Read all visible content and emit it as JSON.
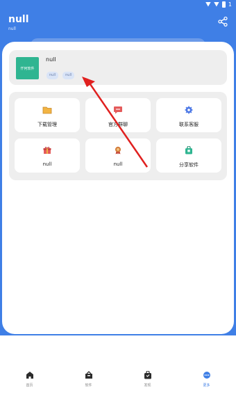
{
  "status_bar": {
    "indicator": "1"
  },
  "header": {
    "title": "null",
    "subtitle": "null",
    "share_icon": "share-icon"
  },
  "profile": {
    "name": "null",
    "avatar_text": "仟何软件",
    "tags": [
      "null",
      "null"
    ]
  },
  "grid": [
    {
      "label": "下载管理",
      "icon": "folder-icon",
      "color": "#e8a23c"
    },
    {
      "label": "官方群聊",
      "icon": "chat-icon",
      "color": "#e14b4b"
    },
    {
      "label": "联系客服",
      "icon": "gear-icon",
      "color": "#3f6de0"
    },
    {
      "label": "null",
      "icon": "gift-icon",
      "color": "#e14b4b"
    },
    {
      "label": "null",
      "icon": "badge-icon",
      "color": "#c76a2b"
    },
    {
      "label": "分享软件",
      "icon": "bag-icon",
      "color": "#2fb591"
    }
  ],
  "bottom_nav": [
    {
      "label": "首页",
      "icon": "home-icon",
      "active": false
    },
    {
      "label": "软件",
      "icon": "apps-icon",
      "active": false
    },
    {
      "label": "发现",
      "icon": "discover-icon",
      "active": false
    },
    {
      "label": "更多",
      "icon": "more-icon",
      "active": true
    }
  ],
  "colors": {
    "accent": "#3f7fe6",
    "arrow": "#e0201f"
  }
}
